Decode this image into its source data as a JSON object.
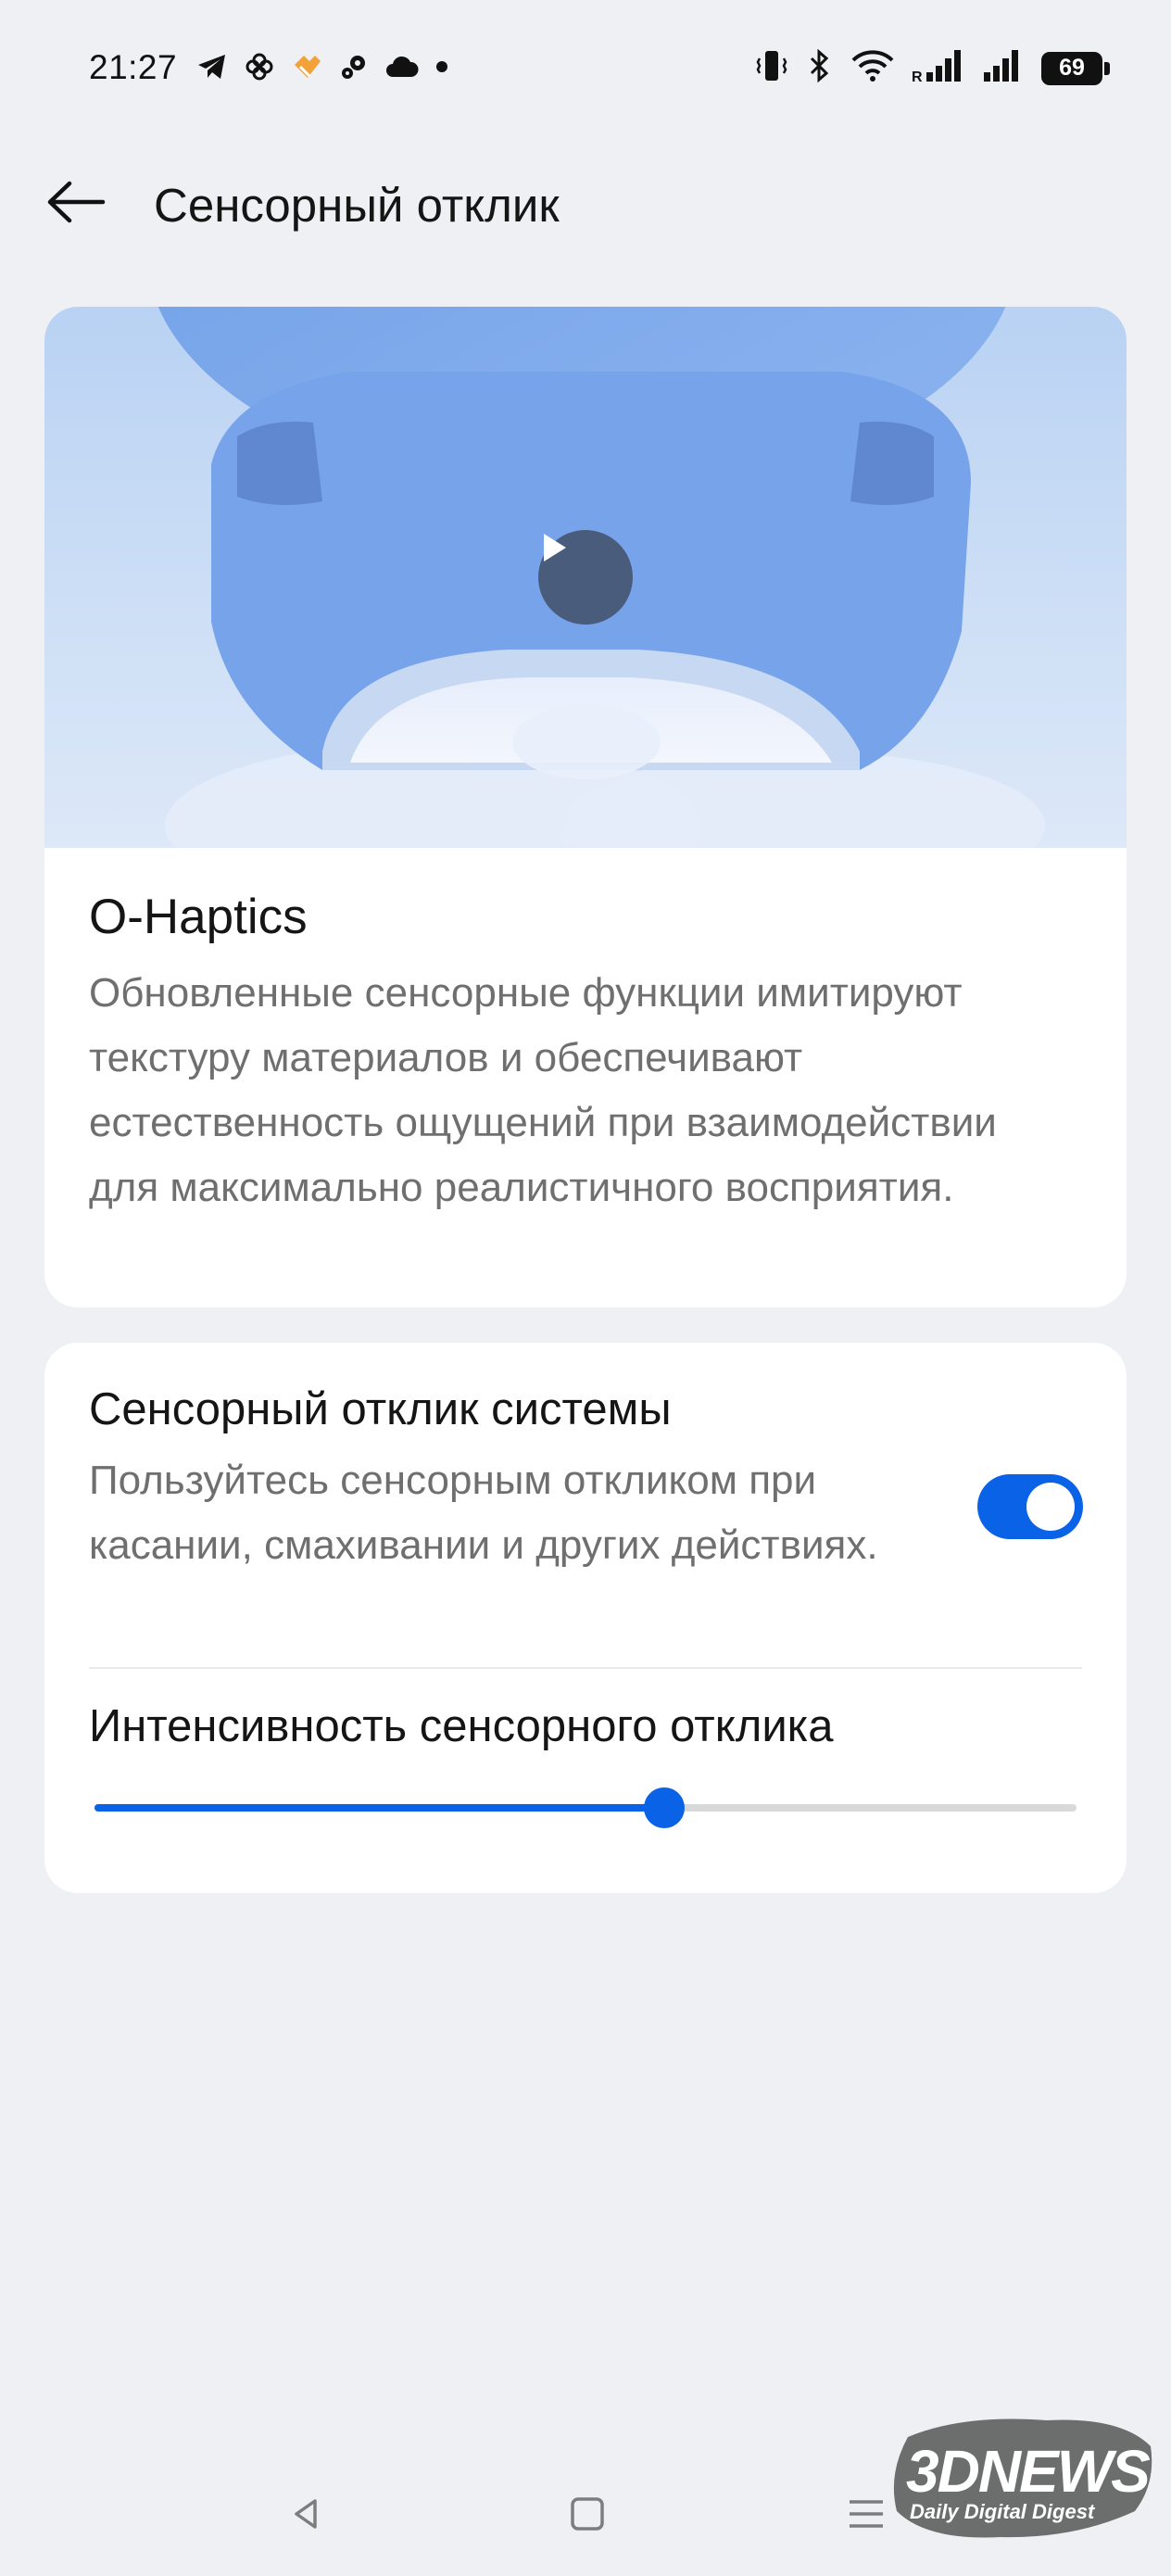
{
  "status_bar": {
    "time": "21:27",
    "left_icons": [
      "telegram-icon",
      "pinwheel-icon",
      "heart-icon",
      "gears-icon",
      "cloud-icon",
      "dot-icon"
    ],
    "right_icons": [
      "vibrate-icon",
      "bluetooth-icon",
      "wifi-icon",
      "roaming-signal-icon",
      "signal-icon",
      "battery-icon"
    ],
    "roaming_label": "R",
    "battery_level": "69"
  },
  "header": {
    "title": "Сенсорный отклик",
    "back_icon": "back-arrow-icon"
  },
  "hero_card": {
    "play_icon": "play-icon",
    "title": "O-Haptics",
    "description": "Обновленные сенсорные функции имитируют текстуру материалов и обеспечивают естественность ощущений при взаимодействии для максимально реалистичного восприятия."
  },
  "settings_card": {
    "system_haptics": {
      "title": "Сенсорный отклик системы",
      "description": "Пользуйтесь сенсорным откликом при касании, смахивании и других действиях.",
      "enabled": true
    },
    "intensity": {
      "title": "Интенсивность сенсорного отклика",
      "value_fraction": 0.58
    }
  },
  "nav_bar": {
    "icons": [
      "nav-back-icon",
      "nav-home-icon",
      "nav-menu-icon"
    ]
  },
  "watermark": {
    "brand": "3DNEWS",
    "tagline": "Daily Digital Digest"
  },
  "colors": {
    "accent": "#0a63e6",
    "background": "#eef0f3",
    "card": "#ffffff",
    "secondary_text": "#6f6f6f"
  }
}
